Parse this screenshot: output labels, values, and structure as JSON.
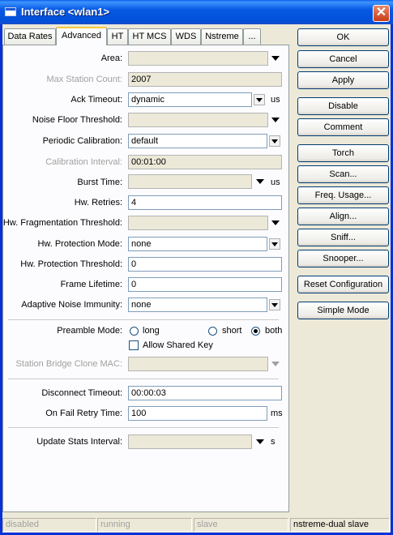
{
  "window": {
    "title": "Interface <wlan1>",
    "close_glyph": "✕"
  },
  "tabs": [
    "Data Rates",
    "Advanced",
    "HT",
    "HT MCS",
    "WDS",
    "Nstreme",
    "..."
  ],
  "active_tab": "Advanced",
  "form": {
    "area": {
      "label": "Area:",
      "value": ""
    },
    "max_station_count": {
      "label": "Max Station Count:",
      "value": "2007"
    },
    "ack_timeout": {
      "label": "Ack Timeout:",
      "value": "dynamic",
      "unit": "us"
    },
    "noise_floor_threshold": {
      "label": "Noise Floor Threshold:",
      "value": ""
    },
    "periodic_calibration": {
      "label": "Periodic Calibration:",
      "value": "default"
    },
    "calibration_interval": {
      "label": "Calibration Interval:",
      "value": "00:01:00"
    },
    "burst_time": {
      "label": "Burst Time:",
      "value": "",
      "unit": "us"
    },
    "hw_retries": {
      "label": "Hw. Retries:",
      "value": "4"
    },
    "hw_fragmentation_threshold": {
      "label": "Hw. Fragmentation Threshold:",
      "value": ""
    },
    "hw_protection_mode": {
      "label": "Hw. Protection Mode:",
      "value": "none"
    },
    "hw_protection_threshold": {
      "label": "Hw. Protection Threshold:",
      "value": "0"
    },
    "frame_lifetime": {
      "label": "Frame Lifetime:",
      "value": "0"
    },
    "adaptive_noise_immunity": {
      "label": "Adaptive Noise Immunity:",
      "value": "none"
    },
    "preamble_mode": {
      "label": "Preamble Mode:",
      "options": [
        "long",
        "short",
        "both"
      ],
      "selected": "both"
    },
    "allow_shared_key": {
      "label": "Allow Shared Key",
      "checked": false
    },
    "station_bridge_clone_mac": {
      "label": "Station Bridge Clone MAC:",
      "value": ""
    },
    "disconnect_timeout": {
      "label": "Disconnect Timeout:",
      "value": "00:00:03"
    },
    "on_fail_retry_time": {
      "label": "On Fail Retry Time:",
      "value": "100",
      "unit": "ms"
    },
    "update_stats_interval": {
      "label": "Update Stats Interval:",
      "value": "",
      "unit": "s"
    }
  },
  "buttons": {
    "ok": "OK",
    "cancel": "Cancel",
    "apply": "Apply",
    "disable": "Disable",
    "comment": "Comment",
    "torch": "Torch",
    "scan": "Scan...",
    "freq_usage": "Freq. Usage...",
    "align": "Align...",
    "sniff": "Sniff...",
    "snooper": "Snooper...",
    "reset_configuration": "Reset Configuration",
    "simple_mode": "Simple Mode"
  },
  "status_bar": [
    "disabled",
    "running",
    "slave",
    "nstreme-dual slave"
  ]
}
